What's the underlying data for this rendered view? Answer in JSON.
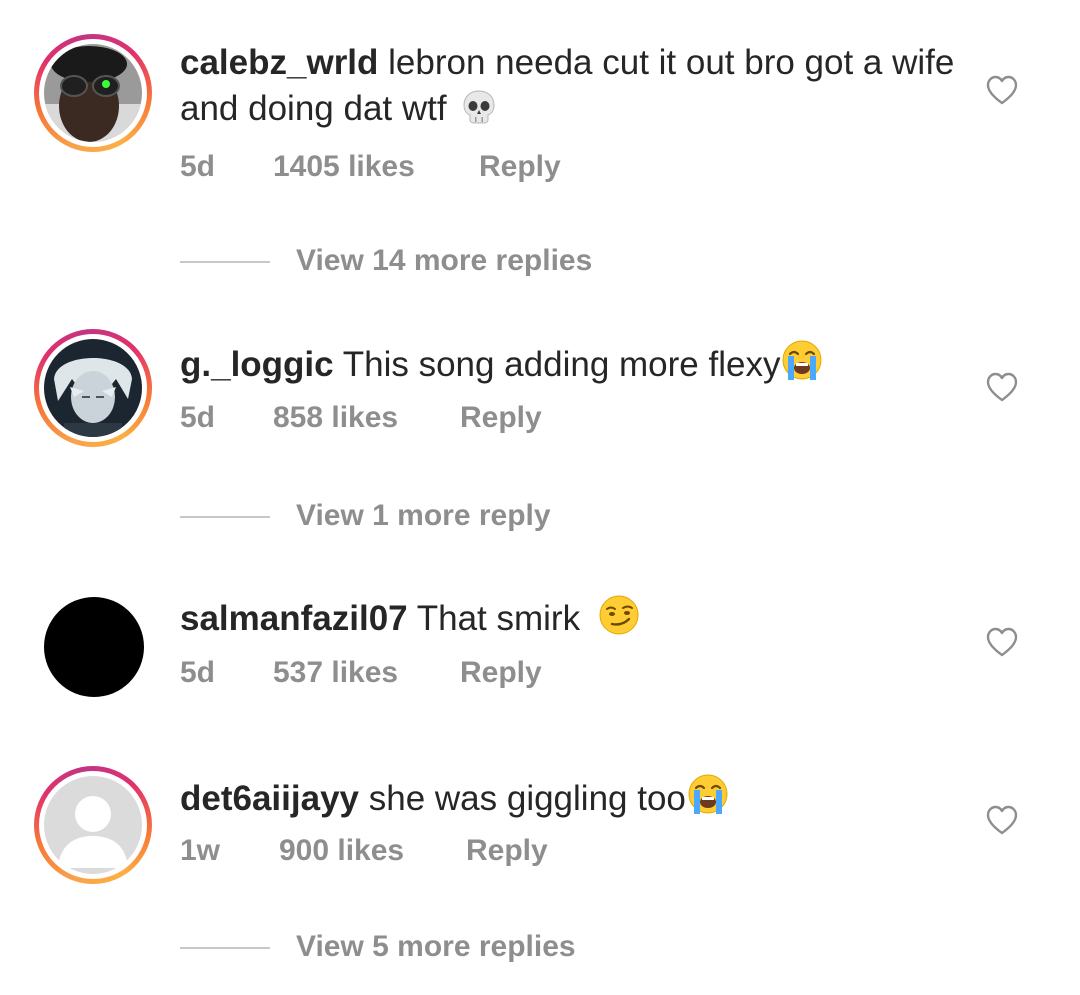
{
  "comments": [
    {
      "username": "calebz_wrld",
      "text": "lebron needa cut it out bro got a wife and doing dat wtf",
      "emoji": "skull-emoji",
      "time": "5d",
      "likes": "1405 likes",
      "reply": "Reply",
      "view_replies": "View 14 more replies"
    },
    {
      "username": "g._loggic",
      "text": "This song adding more flexy",
      "emoji": "loudly-crying-face-emoji",
      "time": "5d",
      "likes": "858 likes",
      "reply": "Reply",
      "view_replies": "View 1 more reply"
    },
    {
      "username": "salmanfazil07",
      "text": "That smirk",
      "emoji": "smirking-face-emoji",
      "time": "5d",
      "likes": "537 likes",
      "reply": "Reply",
      "view_replies": ""
    },
    {
      "username": "det6aiijayy",
      "text": "she was giggling too",
      "emoji": "loudly-crying-face-emoji",
      "time": "1w",
      "likes": "900 likes",
      "reply": "Reply",
      "view_replies": "View 5 more replies"
    }
  ],
  "icons": {
    "like": "heart-outline-icon"
  },
  "colors": {
    "text": "#262626",
    "secondary": "#8e8e8e",
    "story_ring_start": "#e1306c",
    "story_ring_end": "#f9a24a"
  }
}
